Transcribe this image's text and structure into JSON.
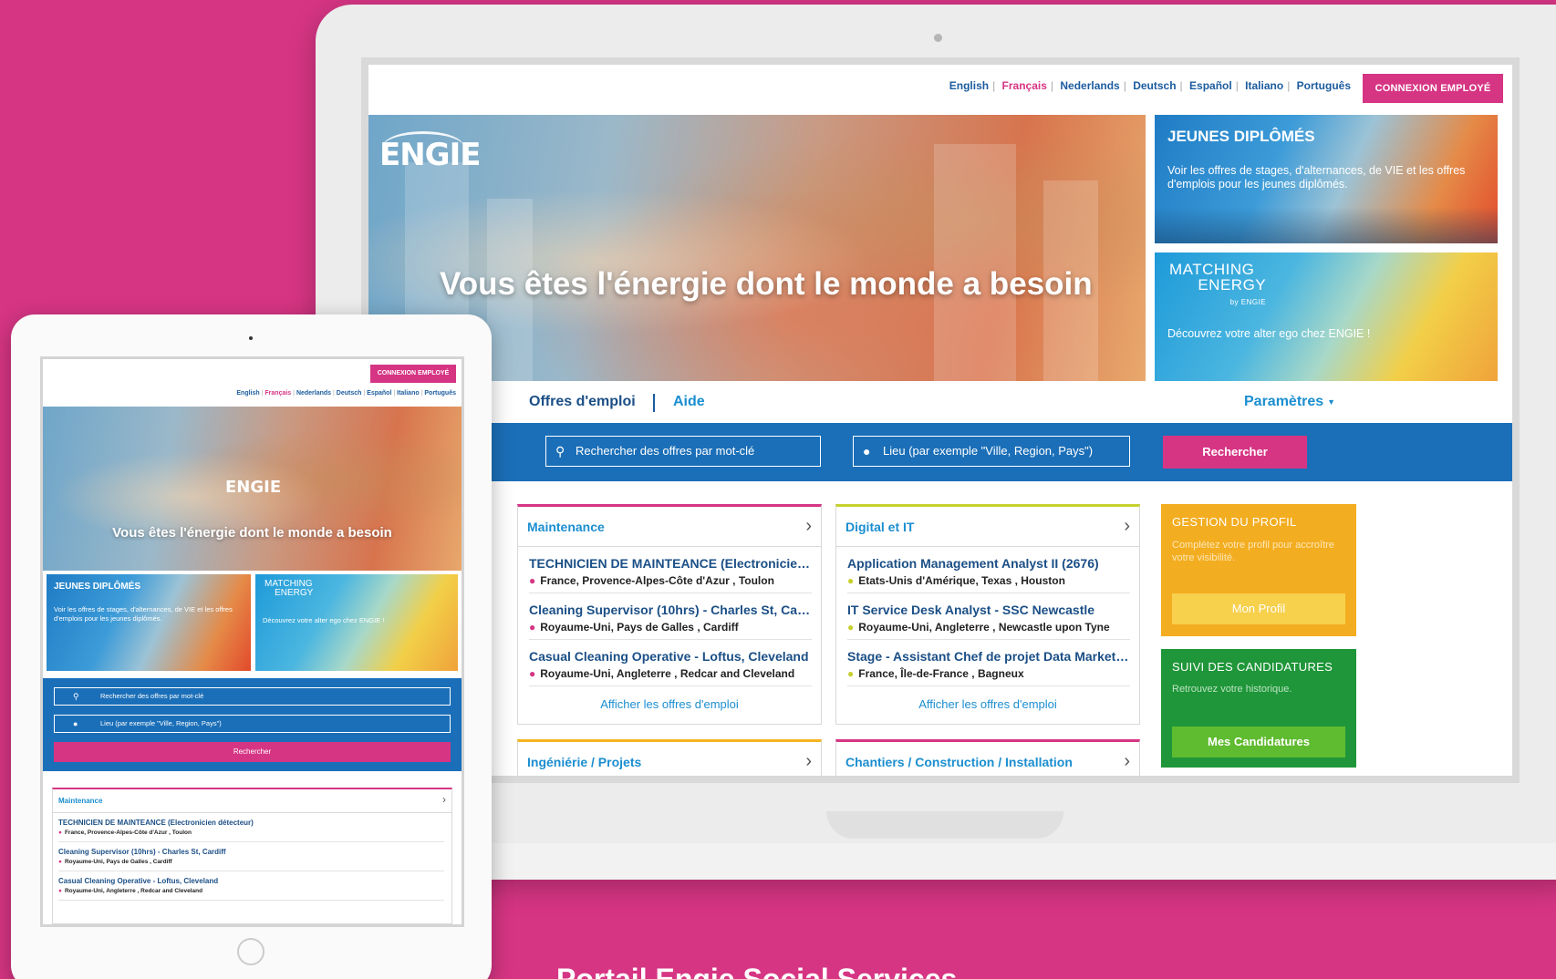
{
  "languages": [
    "English",
    "Français",
    "Nederlands",
    "Deutsch",
    "Español",
    "Italiano",
    "Português"
  ],
  "active_language": "Français",
  "employee_login": "CONNEXION EMPLOYÉ",
  "hero": {
    "logo": "ENGIE",
    "title": "Vous êtes l'énergie dont le monde a besoin"
  },
  "promos": {
    "graduates": {
      "title": "JEUNES DIPLÔMÉS",
      "text": "Voir les offres de stages, d'alternances, de VIE et les offres d'emplois pour les jeunes diplômés."
    },
    "matching": {
      "logo_line1": "MATCHING",
      "logo_line2": "ENERGY",
      "logo_by": "by ENGIE",
      "text": "Découvrez votre alter ego chez ENGIE !"
    }
  },
  "nav": {
    "offers": "Offres d'emploi",
    "help": "Aide",
    "settings": "Paramètres"
  },
  "search": {
    "keyword_placeholder": "Rechercher des offres par mot-clé",
    "location_placeholder": "Lieu (par exemple \"Ville, Region, Pays\")",
    "button": "Rechercher"
  },
  "categories": {
    "maintenance": {
      "title": "Maintenance",
      "jobs": [
        {
          "title": "TECHNICIEN DE MAINTEANCE (Electronicien détecteur)",
          "location": "France, Provence-Alpes-Côte d'Azur , Toulon"
        },
        {
          "title": "Cleaning Supervisor (10hrs) - Charles St, Cardiff",
          "location": "Royaume-Uni, Pays de Galles , Cardiff"
        },
        {
          "title": "Casual Cleaning Operative - Loftus, Cleveland",
          "location": "Royaume-Uni, Angleterre , Redcar and Cleveland"
        }
      ],
      "show_all": "Afficher les offres d'emploi"
    },
    "digital": {
      "title": "Digital et IT",
      "jobs": [
        {
          "title": "Application Management Analyst II (2676)",
          "location": "Etats-Unis d'Amérique, Texas , Houston"
        },
        {
          "title": "IT Service Desk Analyst - SSC Newcastle",
          "location": "Royaume-Uni, Angleterre , Newcastle upon Tyne"
        },
        {
          "title": "Stage - Assistant Chef de projet Data Marketing",
          "location": "France, Île-de-France , Bagneux"
        }
      ],
      "show_all": "Afficher les offres d'emploi"
    },
    "engineering": {
      "title": "Ingéniérie / Projets"
    },
    "construction": {
      "title": "Chantiers / Construction / Installation"
    }
  },
  "profile": {
    "title": "GESTION DU PROFIL",
    "text": "Complétez votre profil pour accroître votre visibilité.",
    "button": "Mon Profil"
  },
  "applications": {
    "title": "SUIVI DES CANDIDATURES",
    "text": "Retrouvez votre historique.",
    "button": "Mes Candidatures"
  },
  "caption": "Portail Engie Social Services",
  "colors": {
    "brand_pink": "#d63584",
    "search_blue": "#1b6fb8",
    "profile_orange": "#f3ad20",
    "applications_green": "#1f9639"
  }
}
